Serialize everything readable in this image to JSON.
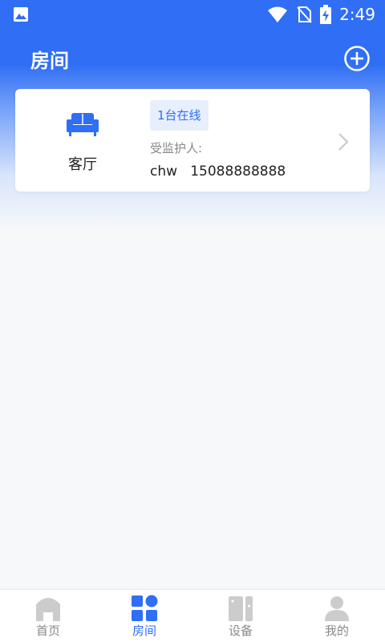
{
  "status": {
    "time": "2:49"
  },
  "header": {
    "title": "房间"
  },
  "room": {
    "name": "客厅",
    "online_badge": "1台在线",
    "guard_label": "受监护人:",
    "guard_value": "chw   15088888888"
  },
  "nav": {
    "items": [
      {
        "label": "首页",
        "icon": "home-icon"
      },
      {
        "label": "房间",
        "icon": "grid-icon"
      },
      {
        "label": "设备",
        "icon": "device-icon"
      },
      {
        "label": "我的",
        "icon": "person-icon"
      }
    ]
  },
  "colors": {
    "primary": "#2f6ef5",
    "inactive": "#cccccc"
  }
}
